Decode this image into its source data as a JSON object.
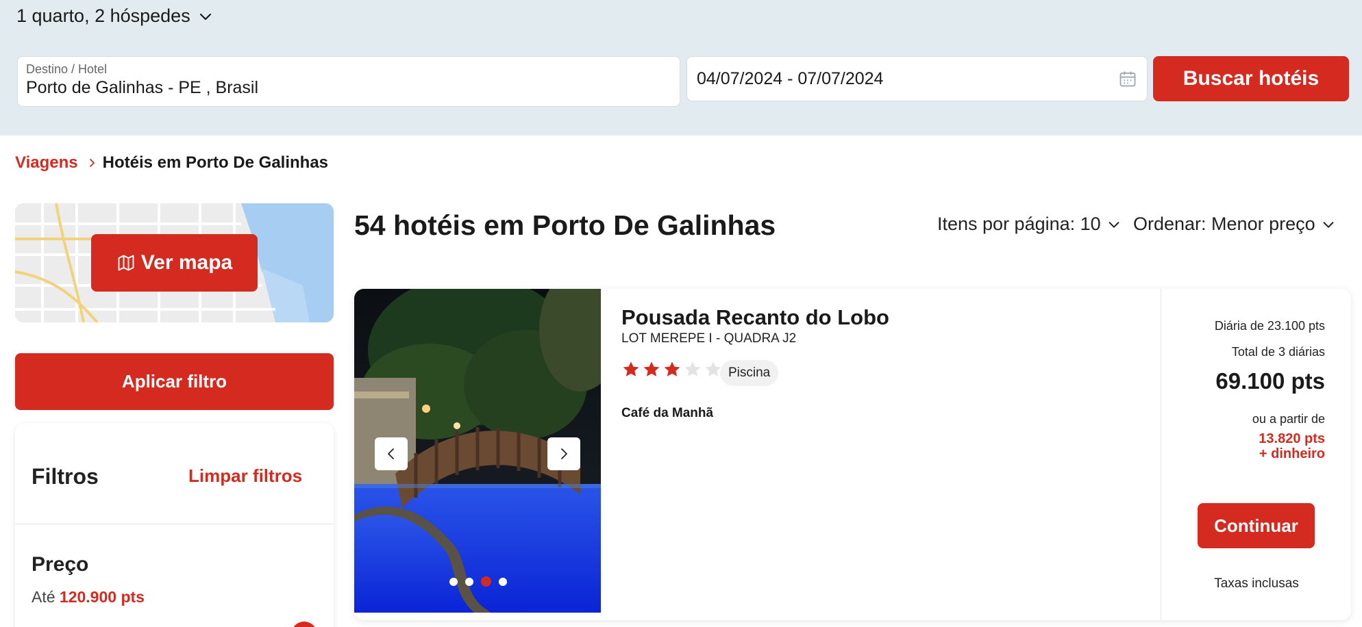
{
  "search": {
    "guests_label": "1 quarto, 2 hóspedes",
    "destination_label": "Destino / Hotel",
    "destination_value": "Porto de Galinhas - PE , Brasil",
    "dates_value": "04/07/2024 - 07/07/2024",
    "search_button": "Buscar hotéis"
  },
  "breadcrumb": {
    "root": "Viagens",
    "current": "Hotéis em Porto De Galinhas"
  },
  "sidebar": {
    "map_button": "Ver mapa",
    "apply_button": "Aplicar filtro",
    "filters_title": "Filtros",
    "clear_filters": "Limpar filtros",
    "price_title": "Preço",
    "price_prefix": "Até",
    "price_value": "120.900 pts"
  },
  "results": {
    "title": "54 hotéis em Porto De Galinhas",
    "per_page": "Itens por página: 10",
    "sort": "Ordenar: Menor preço"
  },
  "hotel": {
    "name": "Pousada Recanto do Lobo",
    "address": "LOT MEREPE I - QUADRA J2",
    "stars_filled": 3,
    "stars_total": 5,
    "amenity": "Piscina",
    "meal": "Café da Manhã",
    "photo_index": 3,
    "photo_count": 4,
    "daily_rate": "Diária de 23.100 pts",
    "total_label": "Total de 3 diárias",
    "total_value": "69.100 pts",
    "or_from": "ou a partir de",
    "mixed_points": "13.820 pts",
    "mixed_cash": "+ dinheiro",
    "continue_button": "Continuar",
    "tax_note": "Taxas inclusas"
  },
  "colors": {
    "accent": "#d42a20",
    "header_band": "#e2ebef",
    "star_empty": "#e3e3e3"
  }
}
